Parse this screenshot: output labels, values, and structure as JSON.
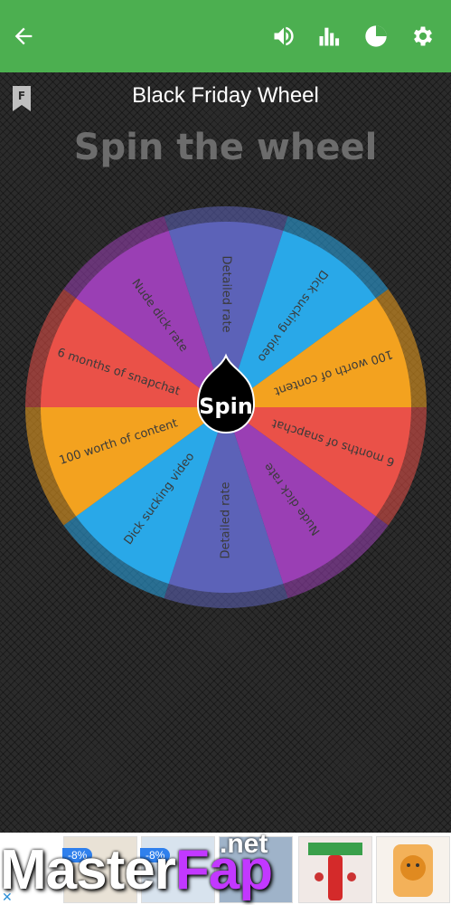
{
  "colors": {
    "toolbar": "#4caf50",
    "blue_violet": "#5c62b8",
    "sky": "#29a8e8",
    "orange": "#f3a21f",
    "red": "#ea5148",
    "purple": "#9a3fb4"
  },
  "toolbar": {
    "back_icon": "arrow-left",
    "sound_icon": "volume",
    "stats_icon": "bar-chart",
    "results_icon": "pie-chart",
    "settings_icon": "gear"
  },
  "header": {
    "title": "Black Friday Wheel",
    "subtitle": "Spin the wheel",
    "bookmark_letter": "F"
  },
  "wheel": {
    "segments": [
      {
        "label": "Detailed rate",
        "color": "#5c62b8"
      },
      {
        "label": "Dick sucking video",
        "color": "#29a8e8"
      },
      {
        "label": "100 worth of content",
        "color": "#f3a21f"
      },
      {
        "label": "6 months of snapchat",
        "color": "#ea5148"
      },
      {
        "label": "Nude dick rate",
        "color": "#9a3fb4"
      },
      {
        "label": "Detailed rate",
        "color": "#5c62b8"
      },
      {
        "label": "Dick sucking video",
        "color": "#29a8e8"
      },
      {
        "label": "100 worth of content",
        "color": "#f3a21f"
      },
      {
        "label": "6 months of snapchat",
        "color": "#ea5148"
      },
      {
        "label": "Nude dick rate",
        "color": "#9a3fb4"
      }
    ],
    "spin_label": "Spin"
  },
  "ad": {
    "badge_1": "-8%",
    "badge_2": "-8%",
    "close": "✕"
  },
  "watermark": {
    "main": "Master",
    "accent": "Fap",
    "suffix": ".net"
  }
}
